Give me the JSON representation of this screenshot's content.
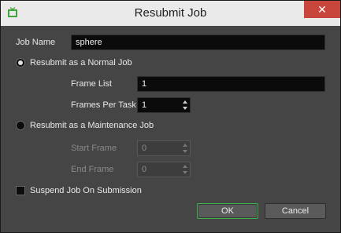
{
  "window": {
    "title": "Resubmit Job",
    "close_glyph": "✕"
  },
  "job": {
    "name_label": "Job Name",
    "name_value": "sphere"
  },
  "normal": {
    "radio_label": "Resubmit as a Normal Job",
    "frame_list_label": "Frame List",
    "frame_list_value": "1",
    "frames_per_task_label": "Frames Per Task",
    "frames_per_task_value": "1",
    "selected": true
  },
  "maintenance": {
    "radio_label": "Resubmit as a Maintenance Job",
    "start_frame_label": "Start Frame",
    "start_frame_value": "0",
    "end_frame_label": "End Frame",
    "end_frame_value": "0",
    "selected": false
  },
  "suspend": {
    "label": "Suspend Job On Submission",
    "checked": false
  },
  "buttons": {
    "ok": "OK",
    "cancel": "Cancel"
  },
  "colors": {
    "accent_ok_border": "#39b54a",
    "close_bg": "#c9463d"
  },
  "icons": {
    "app": "app-tv-icon",
    "close": "close-icon"
  }
}
